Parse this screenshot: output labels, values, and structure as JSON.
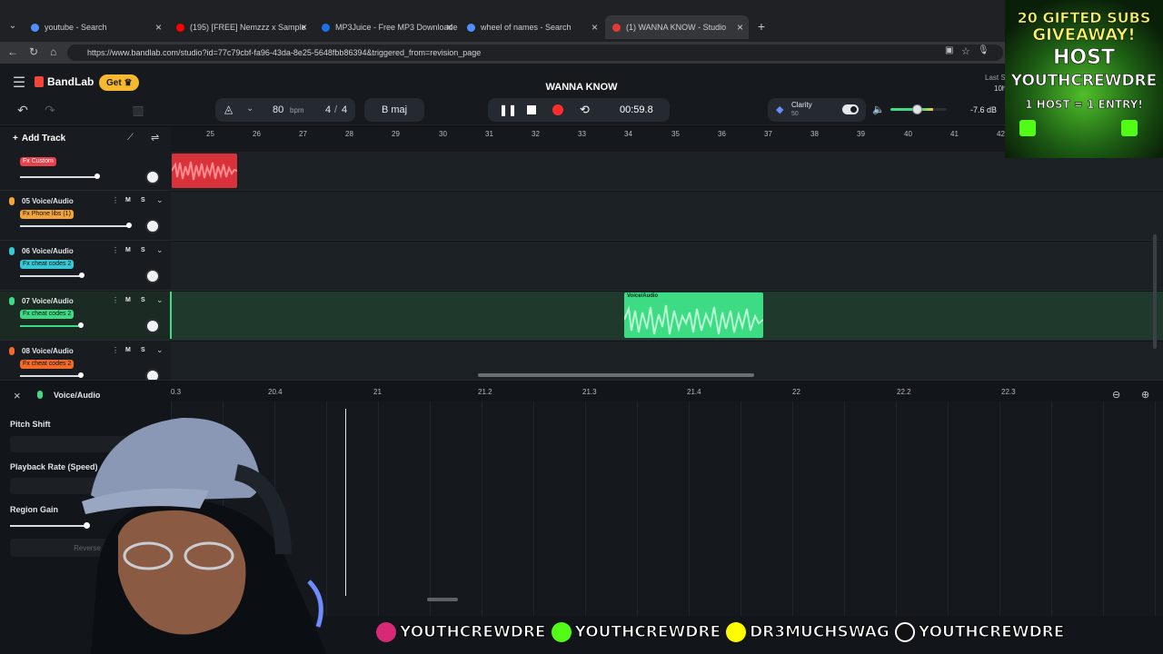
{
  "browser": {
    "tabs": [
      {
        "label": "youtube - Search",
        "color": "#4d90fe"
      },
      {
        "label": "(195) [FREE] Nemzzz x Sample",
        "color": "#ff0000"
      },
      {
        "label": "MP3Juice - Free MP3 Downloader",
        "color": "#1a73e8"
      },
      {
        "label": "wheel of names - Search",
        "color": "#4d90fe"
      },
      {
        "label": "(1) WANNA KNOW - Studio",
        "color": "#e53935"
      }
    ],
    "url": "https://www.bandlab.com/studio?id=77c79cbf-fa96-43da-8e25-5648fbb86394&triggered_from=revision_page"
  },
  "header": {
    "brand": "BandLab",
    "get_label": "Get",
    "project_title": "WANNA KNOW",
    "tempo": "80",
    "tempo_unit": "bpm",
    "time_sig_num": "4",
    "time_sig_den": "4",
    "key": "B maj",
    "time": "00:59.8",
    "clarity_label": "Clarity",
    "clarity_value": "50",
    "volume_db": "-7.6 dB",
    "last_saved": "Last S",
    "last_saved_sub": "10h"
  },
  "toolbar": {
    "add_track": "Add Track"
  },
  "ruler_bars": [
    "25",
    "26",
    "27",
    "28",
    "29",
    "30",
    "31",
    "32",
    "33",
    "34",
    "35",
    "36",
    "37",
    "38",
    "39",
    "40",
    "41",
    "42"
  ],
  "tracks": [
    {
      "name": "",
      "fx": "Fx Custom",
      "fx_color": "#e8414a",
      "mic_color": "#e8414a",
      "vol": 0.7
    },
    {
      "name": "05  Voice/Audio",
      "fx": "Fx Phone libs (1)",
      "fx_color": "#f2a43a",
      "mic_color": "#f2a43a",
      "vol": 0.97
    },
    {
      "name": "06  Voice/Audio",
      "fx": "Fx cheat codes 2",
      "fx_color": "#39c7d6",
      "mic_color": "#39c7d6",
      "vol": 0.55
    },
    {
      "name": "07  Voice/Audio",
      "fx": "Fx cheat codes 2",
      "fx_color": "#3ddc84",
      "mic_color": "#3ddc84",
      "vol": 0.54
    },
    {
      "name": "08  Voice/Audio",
      "fx": "Fx cheat codes 2",
      "fx_color": "#f26a2a",
      "mic_color": "#f26a2a",
      "vol": 0.54
    }
  ],
  "track_buttons": {
    "mute": "M",
    "solo": "S"
  },
  "clips": [
    {
      "label": "",
      "color": "#d9323a"
    },
    {
      "label": "Voice/Audio",
      "color": "#3ddc84"
    }
  ],
  "editor": {
    "track_label": "Voice/Audio",
    "ruler": [
      "0.3",
      "20.4",
      "21",
      "21.2",
      "21.3",
      "21.4",
      "22",
      "22.2",
      "22.3"
    ],
    "props": [
      {
        "label": "Pitch Shift"
      },
      {
        "label": "Playback Rate (Speed)"
      },
      {
        "label": "Region Gain"
      }
    ],
    "reverse_label": "Reverse"
  },
  "overlay": {
    "promo": [
      "20 GIFTED SUBS",
      "GIVEAWAY!",
      "HOST",
      "YOUTHCREWDRE",
      "1 HOST = 1 ENTRY!"
    ],
    "socials": [
      {
        "handle": "YOUTHCREWDRE",
        "color": "#d62976"
      },
      {
        "handle": "YOUTHCREWDRE",
        "color": "#53fc18"
      },
      {
        "handle": "DR3MUCHSWAG",
        "color": "#fffc00"
      },
      {
        "handle": "YOUTHCREWDRE",
        "color": "#111111"
      }
    ]
  }
}
